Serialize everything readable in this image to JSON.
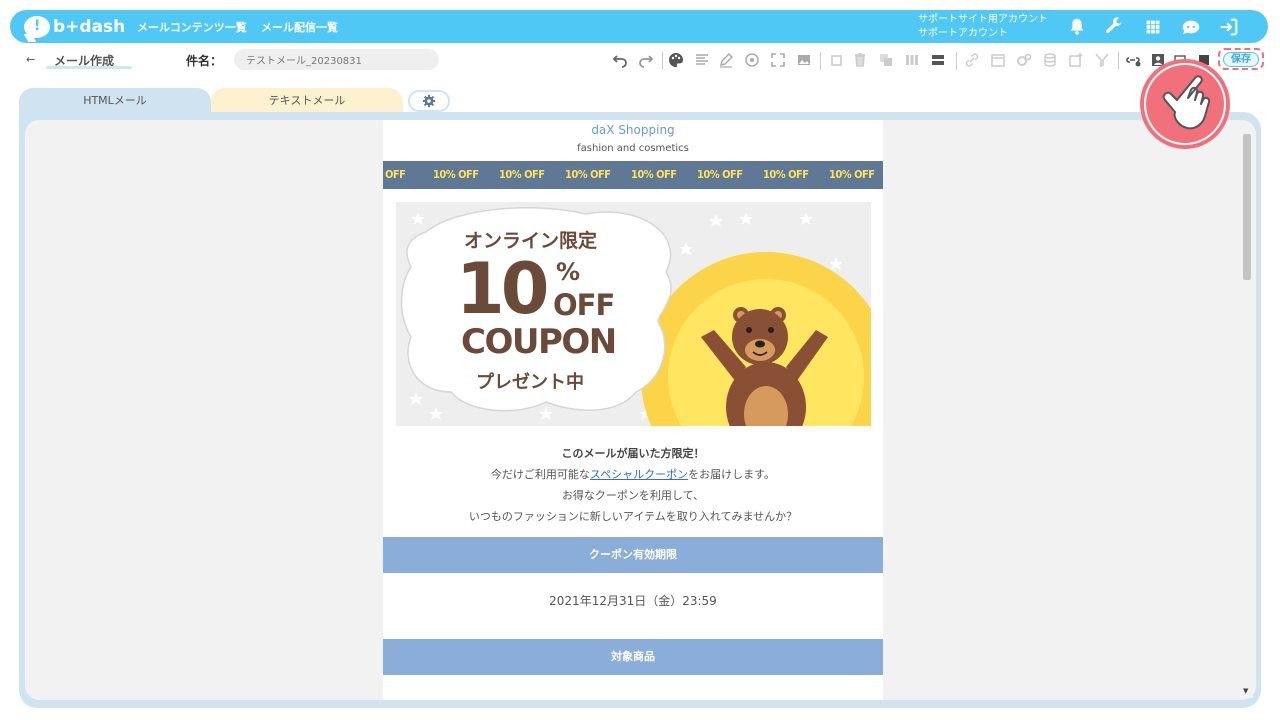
{
  "header": {
    "logo_text": "b+dash",
    "nav": [
      "メールコンテンツ一覧",
      "メール配信一覧"
    ],
    "account_line1": "サポートサイト用アカウント",
    "account_line2": "サポートアカウント",
    "icons": [
      "bell-icon",
      "wrench-icon",
      "grid-icon",
      "support-icon",
      "logout-icon"
    ]
  },
  "toolbar": {
    "back_arrow": "←",
    "page_title": "メール作成",
    "subject_label": "件名：",
    "subject_value": "テストメール_20230831",
    "save_label": "保存",
    "icons": [
      "undo-icon",
      "redo-icon",
      "palette-icon",
      "align-icon",
      "pen-icon",
      "target-icon",
      "expand-icon",
      "image-icon",
      "copy-icon",
      "trash-icon",
      "duplicate-icon",
      "columns-icon",
      "layout-icon",
      "link-icon",
      "calendar-icon",
      "gears-icon",
      "database-icon",
      "add-block-icon",
      "filter-icon",
      "link-settings-icon",
      "contact-icon",
      "device-icon",
      "dark-icon"
    ]
  },
  "tabs": {
    "html": "HTMLメール",
    "text": "テキストメール",
    "settings_icon": "gear-icon"
  },
  "email": {
    "shop_name": "daX Shopping",
    "shop_sub": "fashion and cosmetics",
    "off_strip": [
      "OFF",
      "10% OFF",
      "10% OFF",
      "10% OFF",
      "10% OFF",
      "10% OFF",
      "10% OFF",
      "10% OFF"
    ],
    "banner": {
      "line1": "オンライン限定",
      "big_number": "10",
      "percent": "%",
      "off": "OFF",
      "coupon": "COUPON",
      "present": "プレゼント中"
    },
    "lead_bold": "このメールが届いた方限定！",
    "lead_pre": "今だけご利用可能な",
    "lead_link": "スペシャルクーポン",
    "lead_post": "をお届けします。",
    "line3": "お得なクーポンを利用して、",
    "line4": "いつものファッションに新しいアイテムを取り入れてみませんか？",
    "section1": "クーポン有効期限",
    "expiry": "2021年12月31日（金）23:59",
    "section2": "対象商品"
  },
  "colors": {
    "brand": "#50c8f5",
    "section_bar": "#8aaed9",
    "off_strip_bg": "#5e7896",
    "off_strip_text": "#ffe25b",
    "highlight": "#f0707c"
  }
}
